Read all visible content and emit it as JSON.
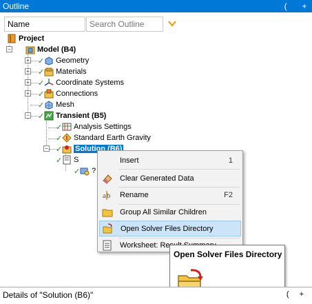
{
  "window": {
    "title": "Outline",
    "controls": [
      "(",
      "+"
    ]
  },
  "toolbar": {
    "name_value": "Name",
    "search_placeholder": "Search Outline"
  },
  "tree": {
    "project": "Project",
    "model": "Model (B4)",
    "geometry": "Geometry",
    "materials": "Materials",
    "coordinate_systems": "Coordinate Systems",
    "connections": "Connections",
    "mesh": "Mesh",
    "transient": "Transient (B5)",
    "analysis_settings": "Analysis Settings",
    "earth_gravity": "Standard Earth Gravity",
    "solution": "Solution (B6)",
    "sol_child_1": "S",
    "sol_child_2": "?"
  },
  "context_menu": {
    "insert": "Insert",
    "insert_sc": "1",
    "clear": "Clear Generated Data",
    "rename": "Rename",
    "rename_sc": "F2",
    "group": "Group All Similar Children",
    "open_solver": "Open Solver Files Directory",
    "worksheet": "Worksheet: Result Summary"
  },
  "tooltip": {
    "title": "Open Solver Files Directory"
  },
  "details": {
    "title": "Details of \"Solution (B6)\"",
    "controls": [
      "(",
      "+"
    ]
  },
  "colors": {
    "accent": "#0078d7",
    "check": "#1a8f1a",
    "menu_hover": "#cce4f7",
    "folder": "#f5c542"
  }
}
